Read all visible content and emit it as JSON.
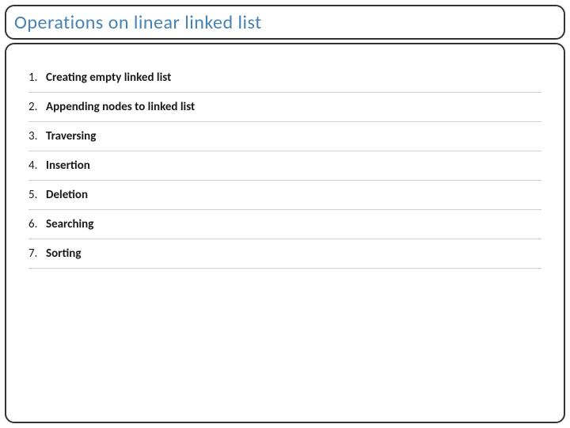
{
  "header": {
    "title": "Operations on linear linked list"
  },
  "list": {
    "items": [
      {
        "num": "1.",
        "text": "Creating empty linked list"
      },
      {
        "num": "2.",
        "text": "Appending nodes to linked list"
      },
      {
        "num": "3.",
        "text": "Traversing"
      },
      {
        "num": "4.",
        "text": "Insertion"
      },
      {
        "num": "5.",
        "text": "Deletion"
      },
      {
        "num": "6.",
        "text": "Searching"
      },
      {
        "num": "7.",
        "text": "Sorting"
      }
    ]
  }
}
